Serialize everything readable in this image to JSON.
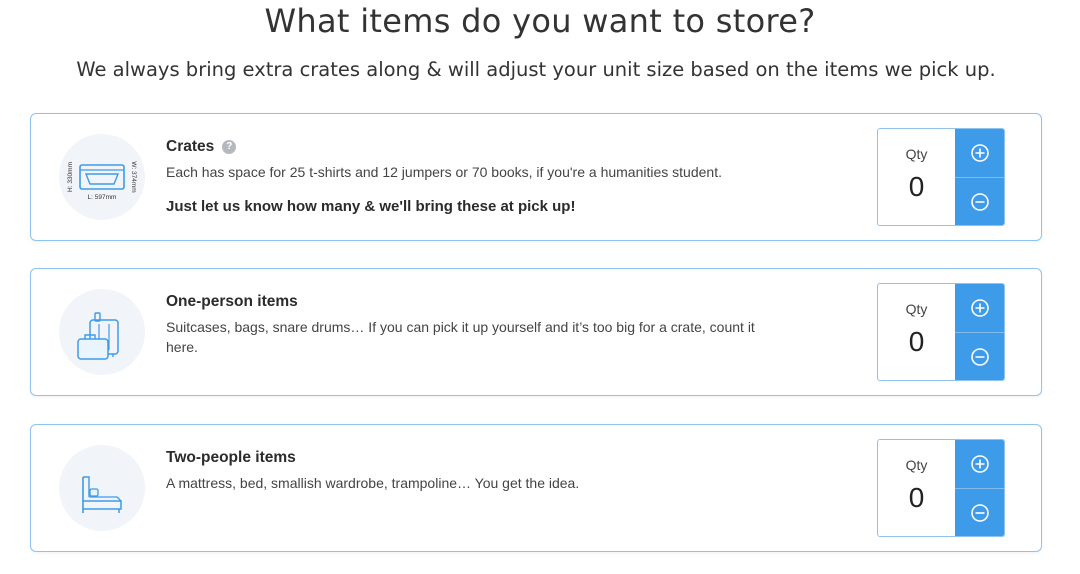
{
  "header": {
    "title": "What items do you want to store?",
    "subtitle": "We always bring extra crates along & will adjust your unit size based on the items we pick up."
  },
  "colors": {
    "accent": "#3d9be9",
    "card_border": "#8ec3f0",
    "icon_bg": "#f1f4f8"
  },
  "items": [
    {
      "title": "Crates",
      "icon": "crate-icon",
      "help_icon": "?",
      "description": "Each has space for 25 t-shirts and 12 jumpers or 70 books, if you're a humanities student.",
      "note": "Just let us know how many & we'll bring these at pick up!",
      "crate_dims": {
        "height": "H: 330mm",
        "width": "W: 374mm",
        "length": "L: 597mm"
      },
      "qty_label": "Qty",
      "qty": "0"
    },
    {
      "title": "One-person items",
      "icon": "luggage-icon",
      "description": "Suitcases, bags, snare drums… If you can pick it up yourself and it’s too big for a crate, count it here.",
      "qty_label": "Qty",
      "qty": "0"
    },
    {
      "title": "Two-people items",
      "icon": "bed-icon",
      "description": "A mattress, bed, smallish wardrobe, trampoline… You get the idea.",
      "qty_label": "Qty",
      "qty": "0"
    }
  ],
  "controls": {
    "increment_icon": "plus-circle-icon",
    "decrement_icon": "minus-circle-icon"
  }
}
